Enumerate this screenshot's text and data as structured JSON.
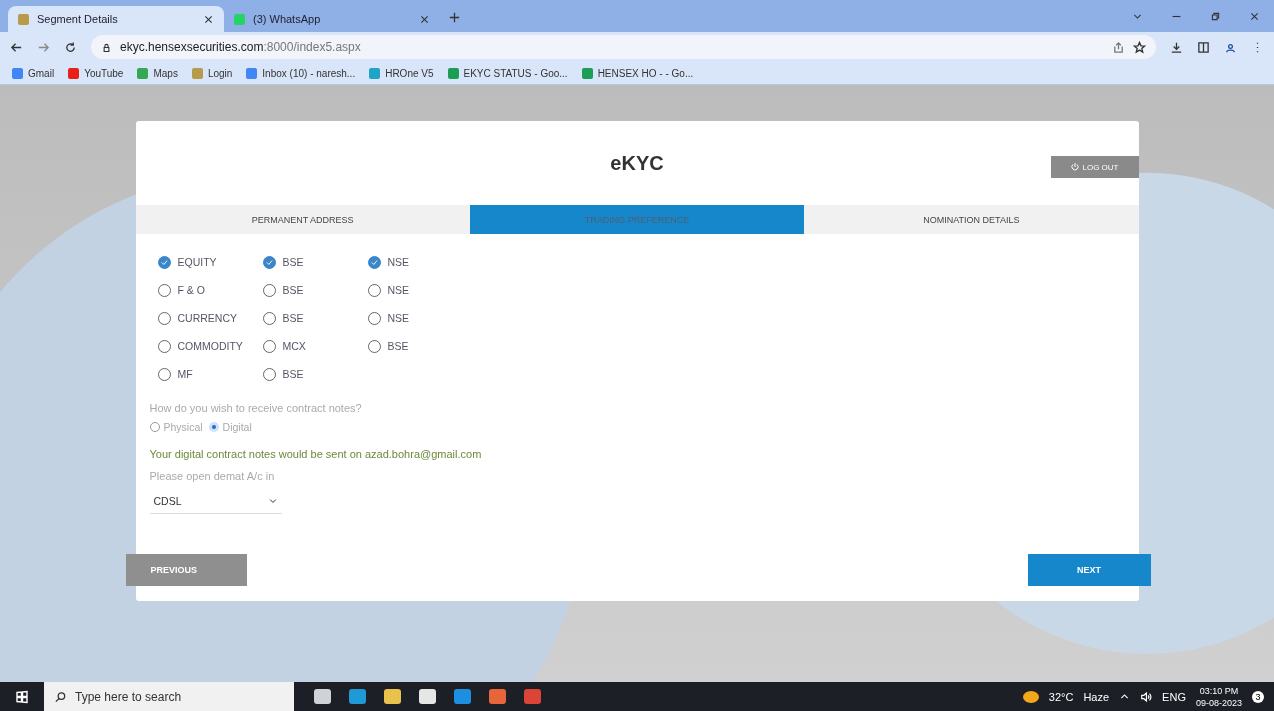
{
  "browser": {
    "tabs": [
      {
        "title": "Segment Details",
        "kind": "site",
        "selected": true
      },
      {
        "title": "(3) WhatsApp",
        "kind": "whatsapp",
        "selected": false
      }
    ],
    "url_host": "ekyc.hensexsecurities.com",
    "url_rest": ":8000/index5.aspx",
    "bookmarks": [
      {
        "label": "Gmail",
        "kind": "google"
      },
      {
        "label": "YouTube",
        "kind": "youtube"
      },
      {
        "label": "Maps",
        "kind": "maps"
      },
      {
        "label": "Login",
        "kind": "site"
      },
      {
        "label": "Inbox (10) - naresh...",
        "kind": "google"
      },
      {
        "label": "HROne V5",
        "kind": "hrone"
      },
      {
        "label": "EKYC STATUS - Goo...",
        "kind": "sheets"
      },
      {
        "label": "HENSEX HO - - Go...",
        "kind": "sheets"
      }
    ]
  },
  "page": {
    "title": "eKYC",
    "logout": "LOG OUT",
    "steps": [
      {
        "label": "PERMANENT ADDRESS",
        "selected": false
      },
      {
        "label": "TRADING PREFERENCE",
        "selected": true
      },
      {
        "label": "NOMINATION DETAILS",
        "selected": false
      }
    ],
    "segments": [
      {
        "label": "EQUITY",
        "checked": true,
        "exchanges": [
          {
            "label": "BSE",
            "checked": true
          },
          {
            "label": "NSE",
            "checked": true
          }
        ]
      },
      {
        "label": "F & O",
        "checked": false,
        "exchanges": [
          {
            "label": "BSE",
            "checked": false
          },
          {
            "label": "NSE",
            "checked": false
          }
        ]
      },
      {
        "label": "CURRENCY",
        "checked": false,
        "exchanges": [
          {
            "label": "BSE",
            "checked": false
          },
          {
            "label": "NSE",
            "checked": false
          }
        ]
      },
      {
        "label": "COMMODITY",
        "checked": false,
        "exchanges": [
          {
            "label": "MCX",
            "checked": false
          },
          {
            "label": "BSE",
            "checked": false
          }
        ]
      },
      {
        "label": "MF",
        "checked": false,
        "exchanges": [
          {
            "label": "BSE",
            "checked": false
          }
        ]
      }
    ],
    "question": "How do you wish to receive contract notes?",
    "delivery": [
      {
        "label": "Physical",
        "selected": false
      },
      {
        "label": "Digital",
        "selected": true
      }
    ],
    "email_note": "Your digital contract notes would be sent on azad.bohra@gmail.com",
    "demat_label": "Please open demat A/c in",
    "demat_value": "CDSL",
    "previous": "PREVIOUS",
    "next": "NEXT"
  },
  "taskbar": {
    "search_placeholder": "Type here to search",
    "temperature": "32°C",
    "weather": "Haze",
    "language": "ENG",
    "time": "03:10 PM",
    "date": "09-08-2023",
    "notifications": "3"
  }
}
